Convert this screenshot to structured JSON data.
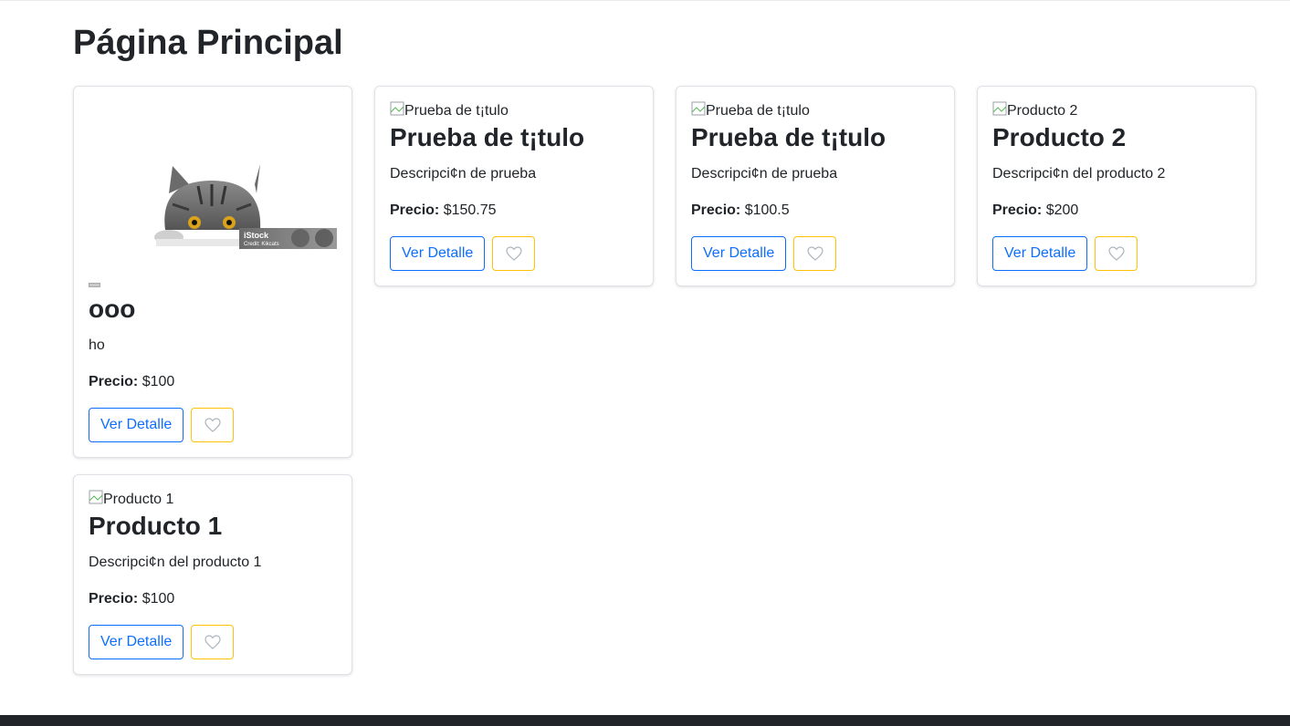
{
  "page": {
    "title": "Página Principal"
  },
  "products": [
    {
      "image_alt": "",
      "title": "ooo",
      "description": "ho",
      "price_label": "Precio:",
      "price": "$100",
      "detail_label": "Ver Detalle",
      "image_watermark": "iStock",
      "image_credit": "Credit: Kikcats"
    },
    {
      "image_alt": "Prueba de t¡tulo",
      "title": "Prueba de t¡tulo",
      "description": "Descripci¢n de prueba",
      "price_label": "Precio:",
      "price": "$150.75",
      "detail_label": "Ver Detalle"
    },
    {
      "image_alt": "Prueba de t¡tulo",
      "title": "Prueba de t¡tulo",
      "description": "Descripci¢n de prueba",
      "price_label": "Precio:",
      "price": "$100.5",
      "detail_label": "Ver Detalle"
    },
    {
      "image_alt": "Producto 2",
      "title": "Producto 2",
      "description": "Descripci¢n del producto 2",
      "price_label": "Precio:",
      "price": "$200",
      "detail_label": "Ver Detalle"
    },
    {
      "image_alt": "Producto 1",
      "title": "Producto 1",
      "description": "Descripci¢n del producto 1",
      "price_label": "Precio:",
      "price": "$100",
      "detail_label": "Ver Detalle"
    }
  ],
  "icons": {
    "favorite": "heart-outline-icon",
    "broken_image": "broken-image-icon"
  },
  "colors": {
    "primary": "#0d6efd",
    "warning": "#ffc107",
    "footer": "#212529"
  }
}
